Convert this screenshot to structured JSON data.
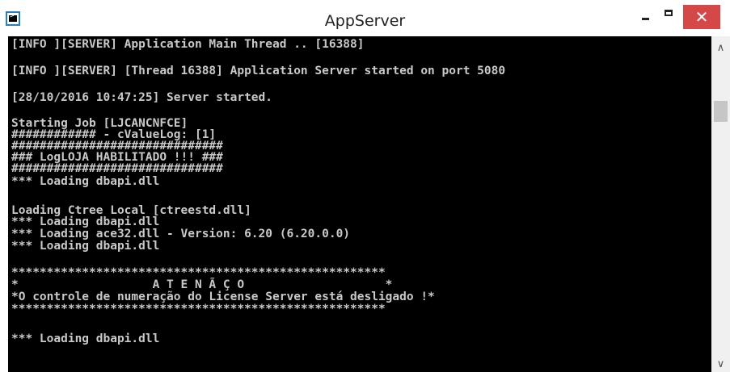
{
  "window": {
    "title": "AppServer"
  },
  "icons": {
    "app": "console-icon",
    "minimize": "minimize-icon",
    "maximize": "maximize-icon",
    "close": "close-icon",
    "scroll_up": "chevron-up-icon",
    "scroll_down": "chevron-down-icon"
  },
  "controls": {
    "close_symbol": "✕",
    "scroll_up_symbol": "∧",
    "scroll_down_symbol": "∨"
  },
  "colors": {
    "console_bg": "#000000",
    "console_text": "#c0c0c0",
    "close_button": "#d44848"
  },
  "console": {
    "lines": [
      "[INFO ][SERVER] Application Main Thread .. [16388]",
      "[INFO ][SERVER] [Thread 16388] Application Server started on port 5080",
      "[28/10/2016 10:47:25] Server started.",
      "Starting Job [LJCANCNFCE]",
      "############ - cValueLog: [1]",
      "##############################",
      "### LogLOJA HABILITADO !!! ###",
      "##############################",
      "*** Loading dbapi.dll",
      "Loading Ctree Local [ctreestd.dll]",
      "*** Loading dbapi.dll",
      "*** Loading ace32.dll - Version: 6.20 (6.20.0.0)",
      "*** Loading dbapi.dll",
      "*****************************************************",
      "*                   A T E N Ã Ç O                    *",
      "*O controle de numeração do License Server está desligado !*",
      "*****************************************************",
      "*** Loading dbapi.dll"
    ]
  }
}
